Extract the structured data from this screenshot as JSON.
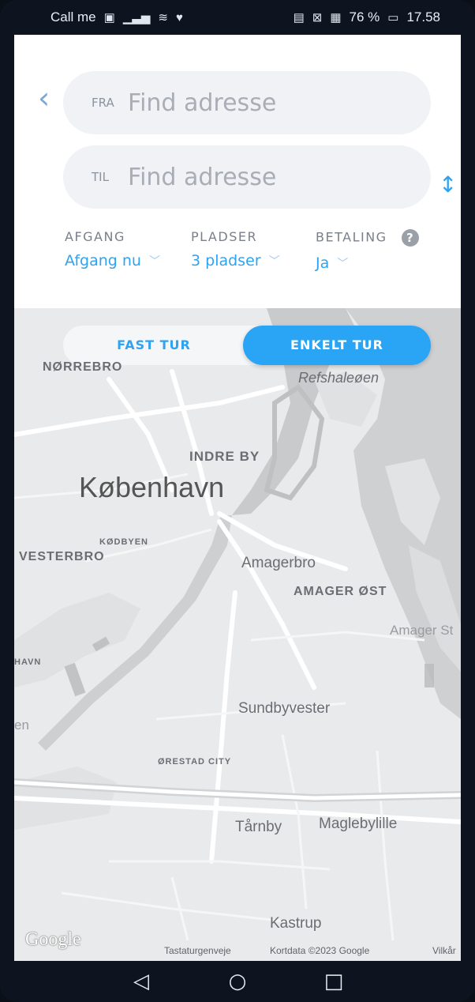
{
  "status_bar": {
    "carrier": "Call me",
    "battery_percent": "76 %",
    "time": "17.58"
  },
  "search": {
    "from_tag": "FRA",
    "from_placeholder": "Find adresse",
    "to_tag": "TIL",
    "to_placeholder": "Find adresse"
  },
  "options": {
    "departure_label": "AFGANG",
    "departure_value": "Afgang nu",
    "seats_label": "PLADSER",
    "seats_value": "3 pladser",
    "payment_label": "BETALING",
    "payment_value": "Ja"
  },
  "trip_type": {
    "fixed_label": "FAST TUR",
    "single_label": "ENKELT TUR",
    "selected": "ENKELT TUR"
  },
  "map": {
    "places": {
      "norrebro": "NØRREBRO",
      "refshaleoen": "Refshaleøen",
      "indre_by": "INDRE BY",
      "kobenhavn": "København",
      "kodbyen": "KØDBYEN",
      "vesterbro": "VESTERBRO",
      "amagerbro": "Amagerbro",
      "amager_ost": "AMAGER ØST",
      "amager_strand": "Amager St",
      "havn": "HAVN",
      "sundbyvester": "Sundbyvester",
      "en": "en",
      "orestad_city": "ØRESTAD CITY",
      "tarnby": "Tårnby",
      "maglebylille": "Maglebylille",
      "kastrup": "Kastrup"
    },
    "google_logo": "Google",
    "attribution": {
      "shortcuts": "Tastaturgenveje",
      "map_data": "Kortdata ©2023 Google",
      "terms": "Vilkår"
    }
  },
  "colors": {
    "accent": "#2ea3f2",
    "field_bg": "#f0f2f5",
    "map_bg": "#e9eaeb"
  }
}
